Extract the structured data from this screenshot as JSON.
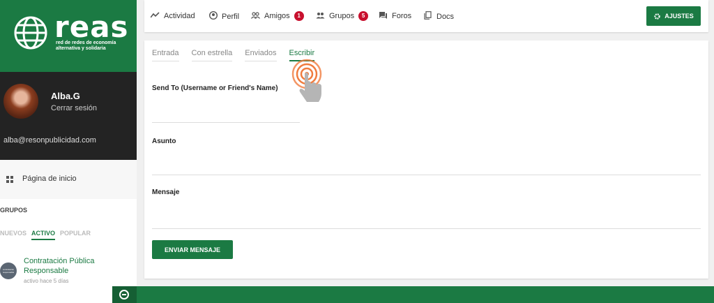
{
  "brand": {
    "name": "reas",
    "tagline_line1": "red de redes de economía",
    "tagline_line2": "alternativa y solidaria",
    "color": "#1b7a43"
  },
  "user": {
    "name": "Alba.G",
    "logout_label": "Cerrar sesión",
    "email": "alba@resonpublicidad.com"
  },
  "sidebar": {
    "home_label": "Página de inicio",
    "groups_title": "GRUPOS",
    "group_tabs": [
      "NUEVOS",
      "ACTIVO",
      "POPULAR"
    ],
    "active_group_tab": "ACTIVO",
    "group": {
      "name": "Contratación Pública Responsable",
      "meta": "activo hace 5 días"
    }
  },
  "nav": {
    "items": [
      {
        "label": "Actividad",
        "icon": "activity-icon"
      },
      {
        "label": "Perfil",
        "icon": "profile-icon"
      },
      {
        "label": "Amigos",
        "icon": "friends-icon",
        "badge": "1"
      },
      {
        "label": "Grupos",
        "icon": "groups-icon",
        "badge": "5"
      },
      {
        "label": "Foros",
        "icon": "forums-icon"
      },
      {
        "label": "Docs",
        "icon": "docs-icon"
      }
    ],
    "settings_label": "AJUSTES"
  },
  "messages": {
    "tabs": [
      "Entrada",
      "Con estrella",
      "Enviados",
      "Escribir"
    ],
    "active_tab": "Escribir",
    "send_to_label": "Send To (Username or Friend's Name)",
    "subject_label": "Asunto",
    "message_label": "Mensaje",
    "send_button": "ENVIAR MENSAJE"
  }
}
